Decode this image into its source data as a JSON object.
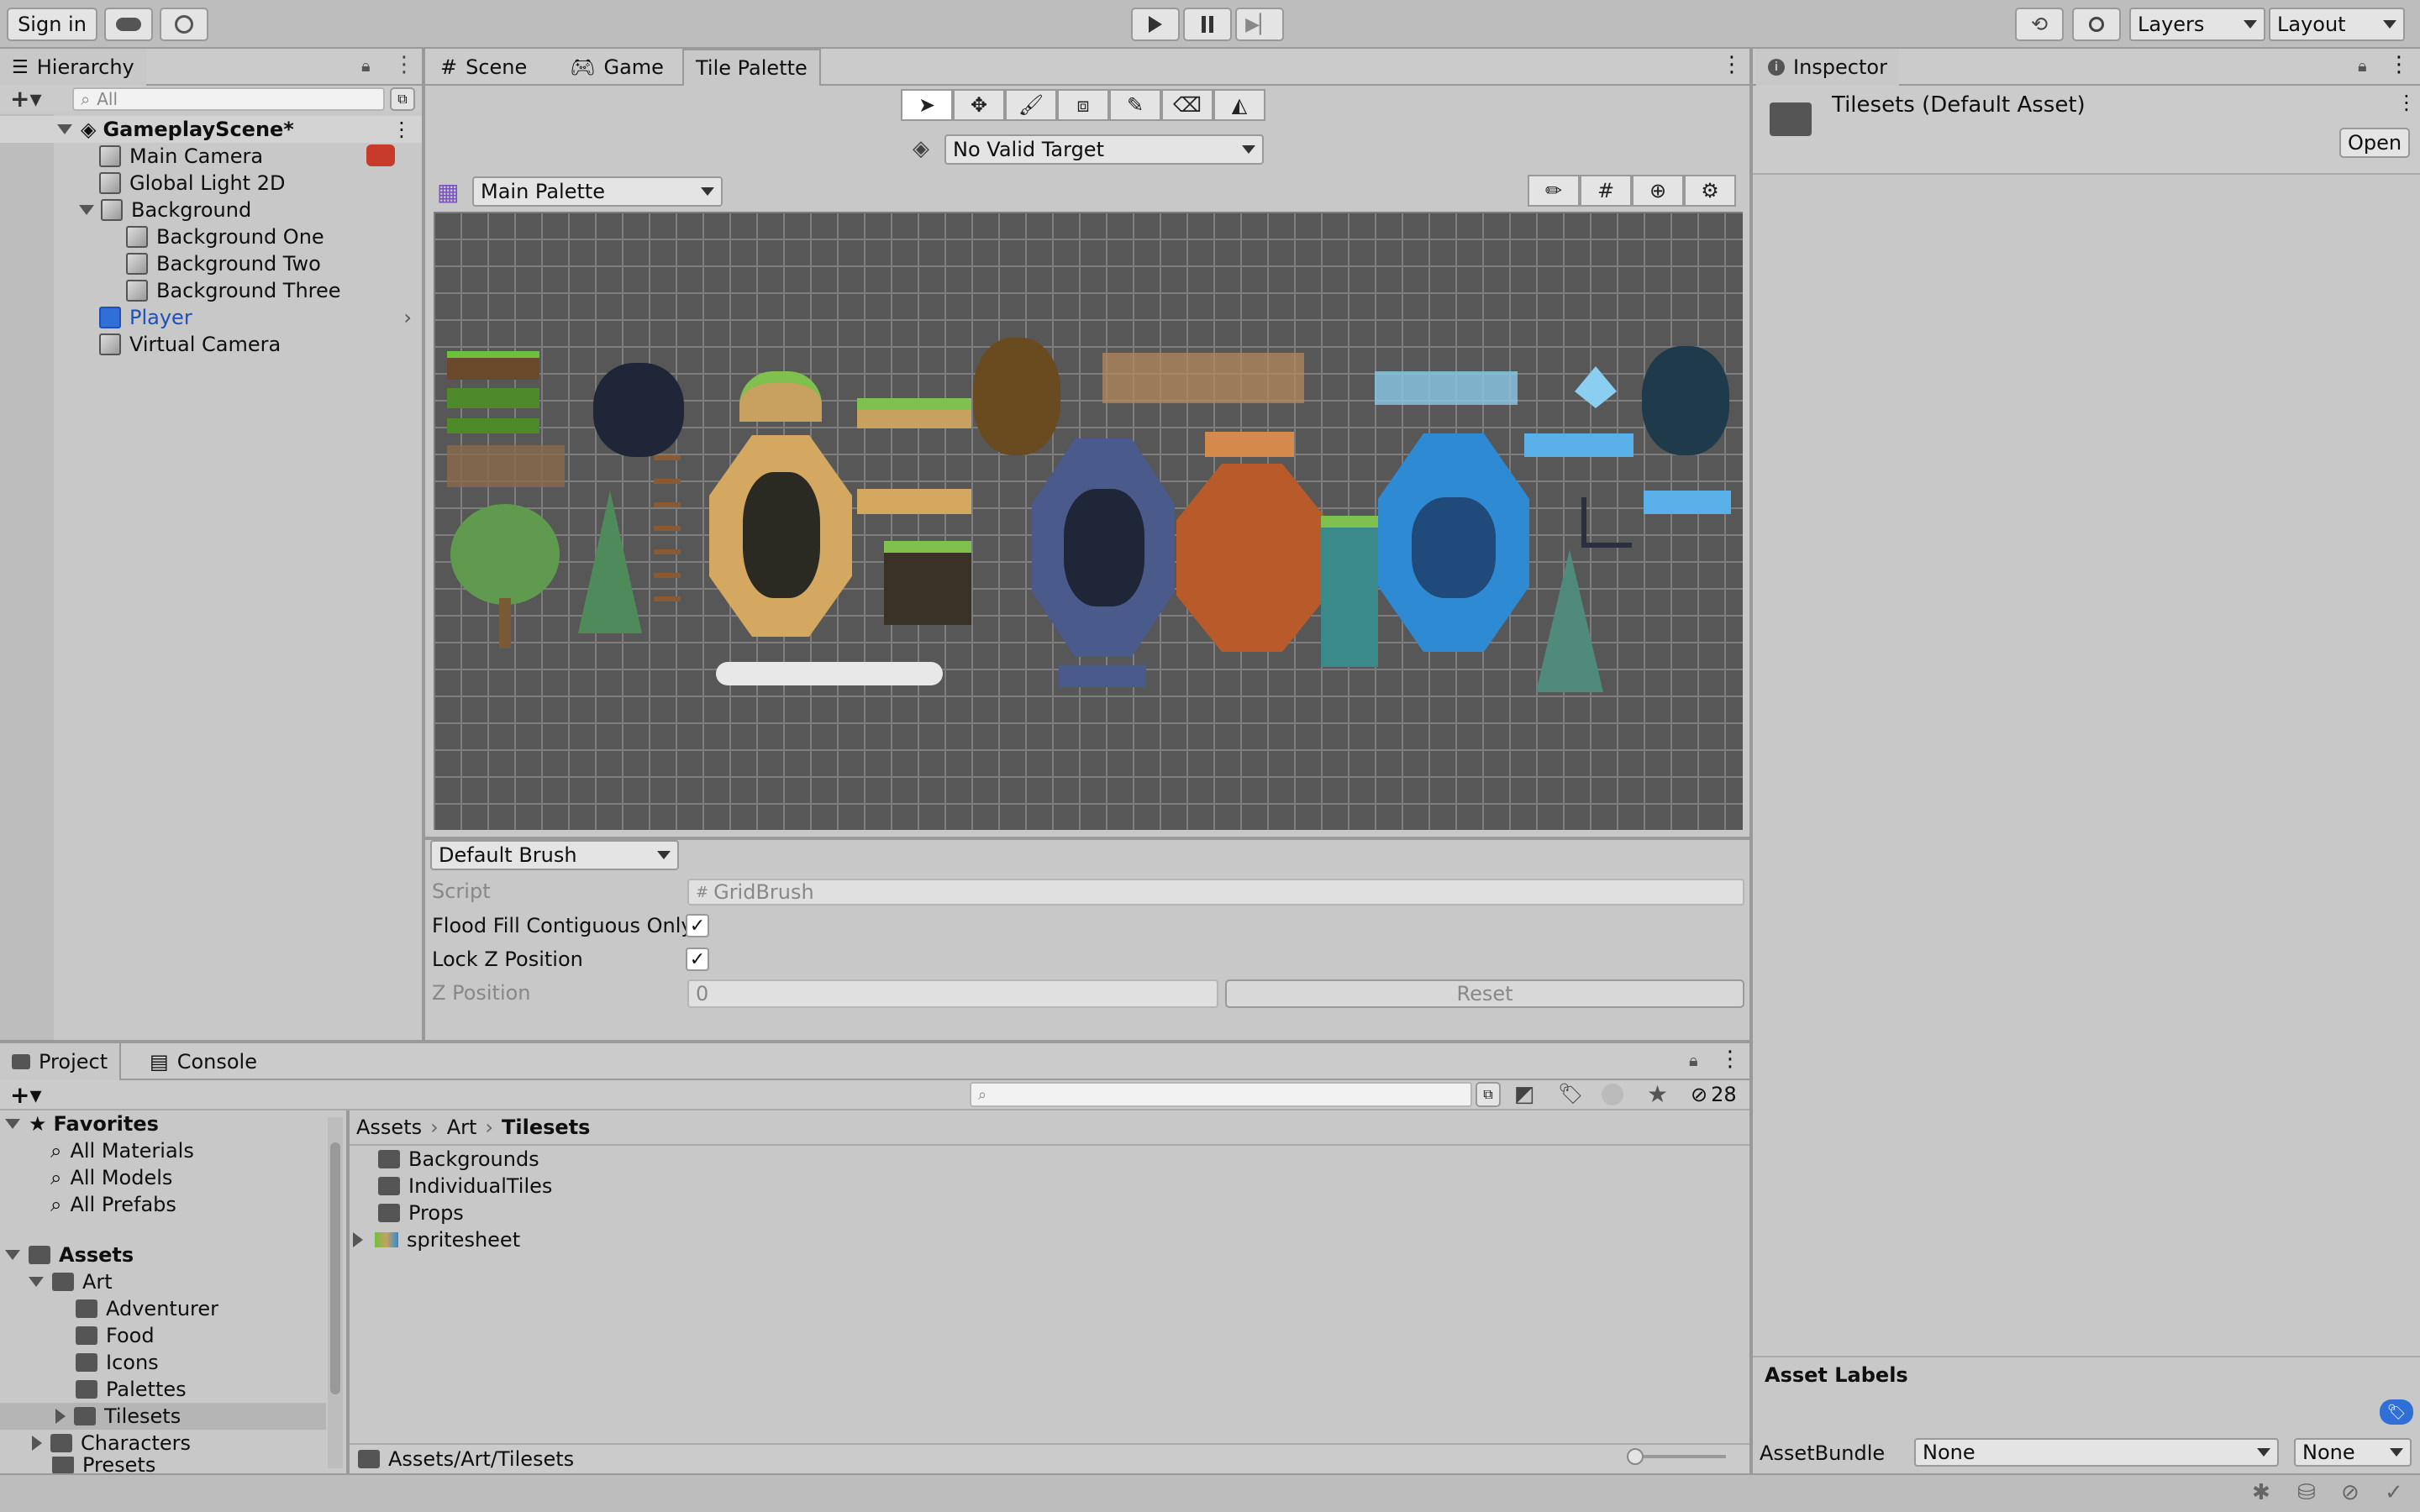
{
  "toolbar": {
    "sign_in": "Sign in",
    "layers": "Layers",
    "layout": "Layout"
  },
  "hierarchy": {
    "tab_label": "Hierarchy",
    "search_placeholder": "All",
    "scene_name": "GameplayScene*",
    "items": [
      {
        "label": "Main Camera",
        "indent": 1
      },
      {
        "label": "Global Light 2D",
        "indent": 1
      },
      {
        "label": "Background",
        "indent": 1
      },
      {
        "label": "Background One",
        "indent": 2
      },
      {
        "label": "Background Two",
        "indent": 2
      },
      {
        "label": "Background Three",
        "indent": 2
      },
      {
        "label": "Player",
        "indent": 1
      },
      {
        "label": "Virtual Camera",
        "indent": 1
      }
    ]
  },
  "center_tabs": {
    "scene": "Scene",
    "game": "Game",
    "tile_palette": "Tile Palette"
  },
  "palette": {
    "target_label": "No Valid Target",
    "palette_name": "Main Palette"
  },
  "brush": {
    "brush_name": "Default Brush",
    "script_label": "Script",
    "script_value": "GridBrush",
    "flood_fill_label": "Flood Fill Contiguous Only",
    "lock_z_label": "Lock Z Position",
    "z_position_label": "Z Position",
    "z_position_value": "0",
    "reset_label": "Reset"
  },
  "inspector": {
    "tab_label": "Inspector",
    "asset_title": "Tilesets (Default Asset)",
    "open_label": "Open",
    "asset_labels": "Asset Labels",
    "asset_bundle_label": "AssetBundle",
    "bundle_value": "None",
    "variant_value": "None"
  },
  "project": {
    "tab_project": "Project",
    "tab_console": "Console",
    "hidden_count": "28",
    "favorites": {
      "label": "Favorites",
      "items": [
        "All Materials",
        "All Models",
        "All Prefabs"
      ]
    },
    "assets_label": "Assets",
    "art_label": "Art",
    "art_children": [
      "Adventurer",
      "Food",
      "Icons",
      "Palettes",
      "Tilesets"
    ],
    "other_folders": [
      "Characters",
      "Presets"
    ],
    "breadcrumb": [
      "Assets",
      "Art",
      "Tilesets"
    ],
    "files": [
      "Backgrounds",
      "IndividualTiles",
      "Props",
      "spritesheet"
    ],
    "status_path": "Assets/Art/Tilesets"
  },
  "colors": {
    "selected_blue": "#1f5fbf",
    "player_blue": "#1f4fbf",
    "grid_bg": "#575757"
  }
}
